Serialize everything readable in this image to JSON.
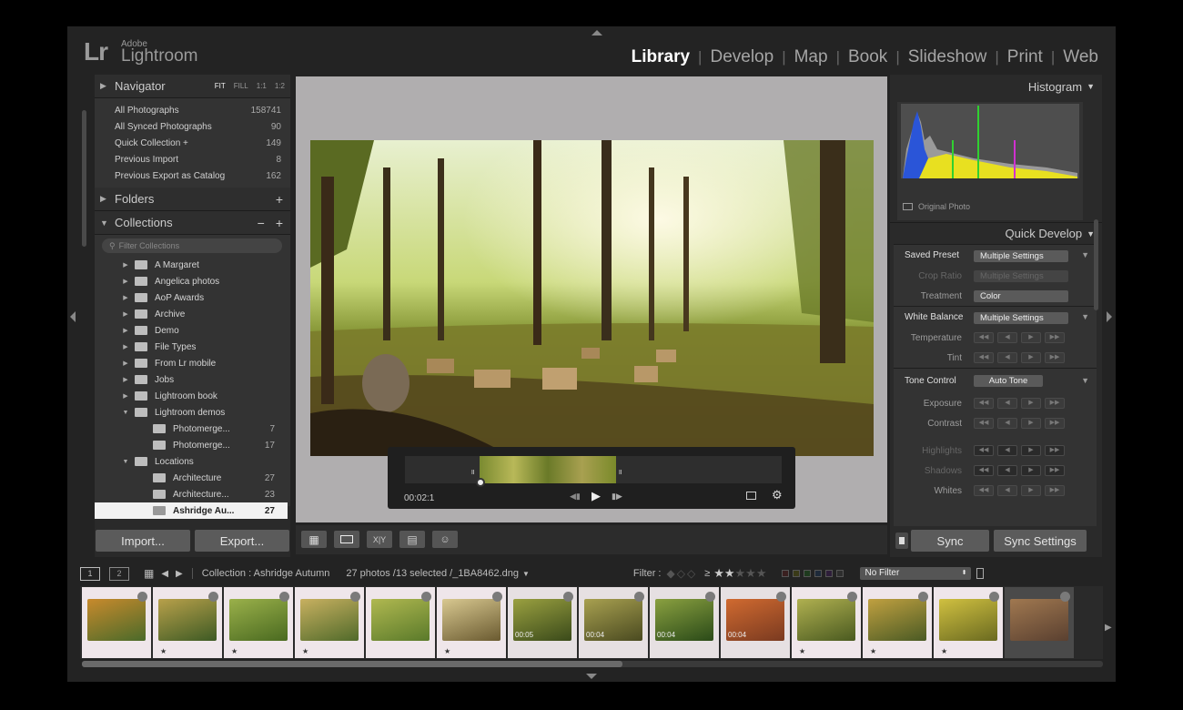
{
  "brand": {
    "logo": "Lr",
    "vendor": "Adobe",
    "product": "Lightroom"
  },
  "modules": [
    "Library",
    "Develop",
    "Map",
    "Book",
    "Slideshow",
    "Print",
    "Web"
  ],
  "active_module": "Library",
  "navigator": {
    "title": "Navigator",
    "zoom_options": [
      "FIT",
      "FILL",
      "1:1",
      "1:2"
    ]
  },
  "catalog": [
    {
      "label": "All Photographs",
      "count": "158741"
    },
    {
      "label": "All Synced Photographs",
      "count": "90"
    },
    {
      "label": "Quick Collection +",
      "count": "149"
    },
    {
      "label": "Previous Import",
      "count": "8"
    },
    {
      "label": "Previous Export as Catalog",
      "count": "162"
    }
  ],
  "folders": {
    "title": "Folders",
    "add": "+"
  },
  "collections": {
    "title": "Collections",
    "minus": "−",
    "add": "+",
    "filter_placeholder": "Filter Collections",
    "items": [
      {
        "label": "A Margaret",
        "count": ""
      },
      {
        "label": "Angelica photos",
        "count": ""
      },
      {
        "label": "AoP Awards",
        "count": ""
      },
      {
        "label": "Archive",
        "count": ""
      },
      {
        "label": "Demo",
        "count": ""
      },
      {
        "label": "File Types",
        "count": ""
      },
      {
        "label": "From Lr mobile",
        "count": ""
      },
      {
        "label": "Jobs",
        "count": ""
      },
      {
        "label": "Lightroom book",
        "count": ""
      },
      {
        "label": "Lightroom demos",
        "count": ""
      },
      {
        "label": "Photomerge...",
        "count": "7"
      },
      {
        "label": "Photomerge...",
        "count": "17"
      },
      {
        "label": "Locations",
        "count": ""
      },
      {
        "label": "Architecture",
        "count": "27"
      },
      {
        "label": "Architecture...",
        "count": "23"
      },
      {
        "label": "Ashridge Au...",
        "count": "27"
      }
    ]
  },
  "left_buttons": {
    "import": "Import...",
    "export": "Export..."
  },
  "video": {
    "time": "00:02:1"
  },
  "histogram": {
    "title": "Histogram",
    "original": "Original Photo"
  },
  "quick_develop": {
    "title": "Quick Develop",
    "saved_preset_label": "Saved Preset",
    "saved_preset_value": "Multiple Settings",
    "crop_label": "Crop Ratio",
    "crop_value": "Multiple Settings",
    "treatment_label": "Treatment",
    "treatment_value": "Color",
    "wb_label": "White Balance",
    "wb_value": "Multiple Settings",
    "temperature_label": "Temperature",
    "tint_label": "Tint",
    "tone_label": "Tone Control",
    "auto_tone": "Auto Tone",
    "exposure_label": "Exposure",
    "contrast_label": "Contrast",
    "highlights_label": "Highlights",
    "shadows_label": "Shadows",
    "whites_label": "Whites"
  },
  "right_buttons": {
    "sync": "Sync",
    "sync_settings": "Sync Settings"
  },
  "filmstrip_bar": {
    "screen1": "1",
    "screen2": "2",
    "source": "Collection : Ashridge Autumn",
    "info": "27 photos /13 selected /_1BA8462.dng",
    "filter_label": "Filter :",
    "rating_op": "≥",
    "filter_value": "No Filter"
  },
  "thumbs": [
    {
      "dur": "",
      "star": "",
      "c1": "#c88a2c",
      "c2": "#4a6a2a"
    },
    {
      "dur": "",
      "star": "★",
      "c1": "#b8a04a",
      "c2": "#3d5a24"
    },
    {
      "dur": "",
      "star": "★",
      "c1": "#9ab04a",
      "c2": "#4a6a20"
    },
    {
      "dur": "",
      "star": "★",
      "c1": "#c8b060",
      "c2": "#506a2a"
    },
    {
      "dur": "",
      "star": "",
      "c1": "#b0b850",
      "c2": "#5a7a2a"
    },
    {
      "dur": "",
      "star": "★",
      "c1": "#d8c890",
      "c2": "#6a5a30"
    },
    {
      "dur": "00:05",
      "star": "",
      "c1": "#9aa040",
      "c2": "#3a4a1a"
    },
    {
      "dur": "00:04",
      "star": "",
      "c1": "#a8a050",
      "c2": "#4a4a20"
    },
    {
      "dur": "00:04",
      "star": "",
      "c1": "#8aa040",
      "c2": "#2a4a18"
    },
    {
      "dur": "00:04",
      "star": "",
      "c1": "#d06a30",
      "c2": "#7a3a20"
    },
    {
      "dur": "",
      "star": "★",
      "c1": "#b0b050",
      "c2": "#4a5a20"
    },
    {
      "dur": "",
      "star": "★",
      "c1": "#c0a040",
      "c2": "#4a5a24"
    },
    {
      "dur": "",
      "star": "★",
      "c1": "#d0c040",
      "c2": "#6a6a20"
    },
    {
      "dur": "",
      "star": "",
      "c1": "#a07850",
      "c2": "#5a4030"
    }
  ]
}
